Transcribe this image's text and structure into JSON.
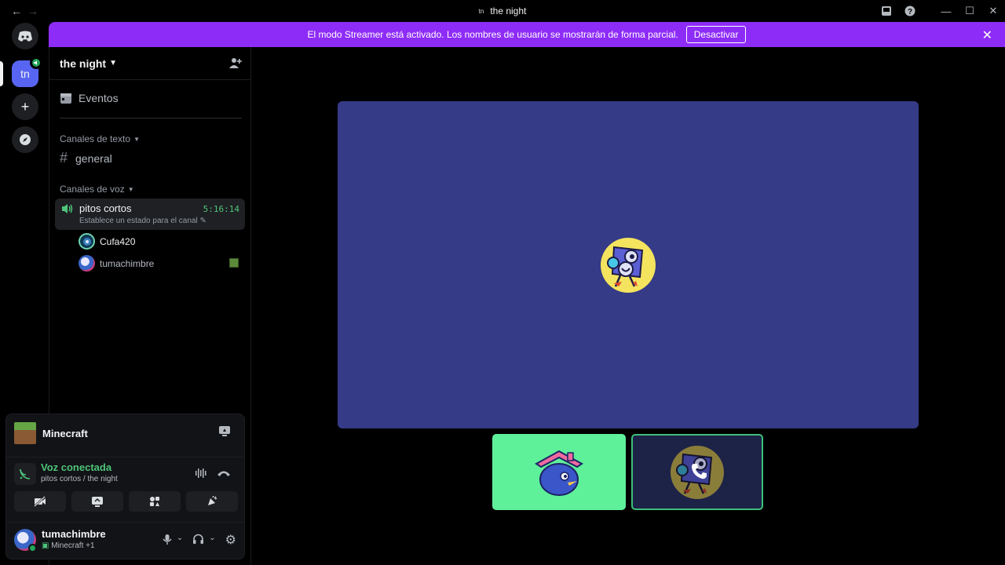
{
  "titlebar": {
    "server_initials": "tn",
    "title": "the night"
  },
  "banner": {
    "message": "El modo Streamer está activado. Los nombres de usuario se mostrarán de forma parcial.",
    "deactivate_label": "Desactivar"
  },
  "rail": {
    "active_server": "tn"
  },
  "guild": {
    "name": "the night",
    "events_label": "Eventos",
    "text_category": "Canales de texto",
    "text_channels": [
      "general"
    ],
    "voice_category": "Canales de voz",
    "voice_channel": {
      "name": "pitos cortos",
      "timer": "5:16:14",
      "status_placeholder": "Establece un estado para el canal"
    },
    "members": [
      {
        "name": "Cufa420"
      },
      {
        "name": "tumachimbre"
      }
    ]
  },
  "activity": {
    "game": "Minecraft",
    "voice_title": "Voz conectada",
    "voice_sub": "pitos cortos / the night"
  },
  "user": {
    "name": "tumachimbre",
    "status": "Minecraft +1"
  },
  "colors": {
    "accent": "#5865f2",
    "banner": "#8e2cf7",
    "voice_green": "#4ec47a",
    "stage_bg": "#353b86"
  }
}
